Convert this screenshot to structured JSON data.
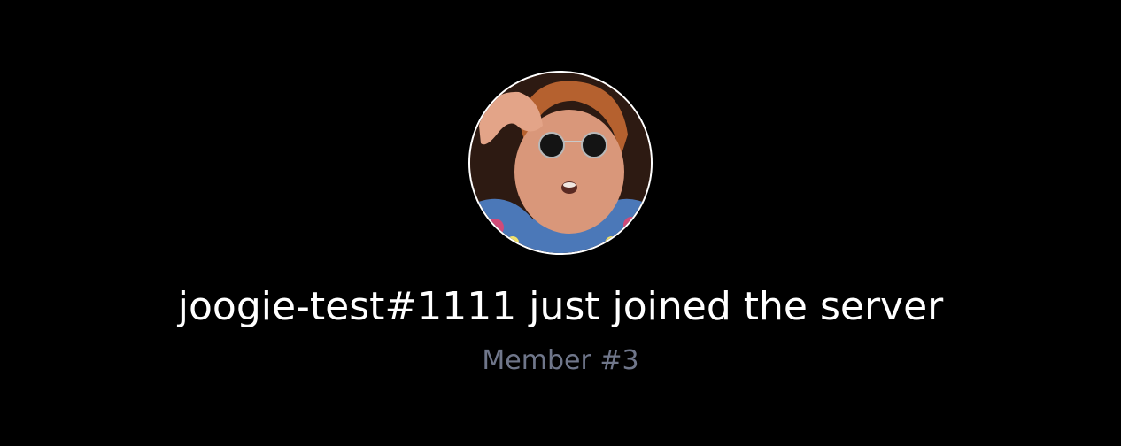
{
  "welcome": {
    "headline": "joogie-test#1111 just joined the server",
    "member_count": "Member #3"
  },
  "colors": {
    "background": "#000000",
    "headline": "#ffffff",
    "subline": "#6f768a",
    "avatar_border": "#ffffff"
  },
  "icons": {
    "avatar": "user-avatar-photo"
  }
}
